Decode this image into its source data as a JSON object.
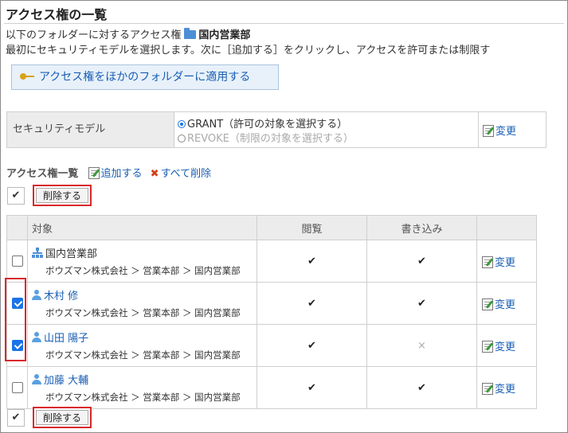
{
  "title": "アクセス権の一覧",
  "desc_line1_prefix": "以下のフォルダーに対するアクセス権",
  "folder_name": "国内営業部",
  "desc_line2": "最初にセキュリティモデルを選択します。次に［追加する］をクリックし、アクセスを許可または制限す",
  "apply_button": "アクセス権をほかのフォルダーに適用する",
  "security_model": {
    "label": "セキュリティモデル",
    "grant_label": "GRANT（許可の対象を選択する）",
    "revoke_label": "REVOKE（制限の対象を選択する）",
    "selected": "GRANT",
    "change_label": "変更"
  },
  "list": {
    "heading": "アクセス権一覧",
    "add_label": "追加する",
    "delete_all_label": "すべて削除",
    "check_all_glyph": "✔",
    "delete_button": "削除する"
  },
  "table": {
    "headers": [
      "対象",
      "閲覧",
      "書き込み"
    ],
    "rows": [
      {
        "type": "organization",
        "name": "国内営業部",
        "path": "ボウズマン株式会社 ＞ 営業本部 ＞ 国内営業部",
        "checked": false,
        "view": "✔",
        "write": "✔",
        "change": "変更"
      },
      {
        "type": "user",
        "name": "木村 修",
        "path": "ボウズマン株式会社 ＞ 営業本部 ＞ 国内営業部",
        "checked": true,
        "view": "✔",
        "write": "✔",
        "change": "変更"
      },
      {
        "type": "user",
        "name": "山田 陽子",
        "path": "ボウズマン株式会社 ＞ 営業本部 ＞ 国内営業部",
        "checked": true,
        "view": "✔",
        "write": "×",
        "change": "変更"
      },
      {
        "type": "user",
        "name": "加藤 大輔",
        "path": "ボウズマン株式会社 ＞ 営業本部 ＞ 国内営業部",
        "checked": false,
        "view": "✔",
        "write": "✔",
        "change": "変更"
      }
    ]
  },
  "colors": {
    "link": "#1a5fb4",
    "highlight": "#d9282c",
    "checkbox_on": "#1a73e8"
  }
}
